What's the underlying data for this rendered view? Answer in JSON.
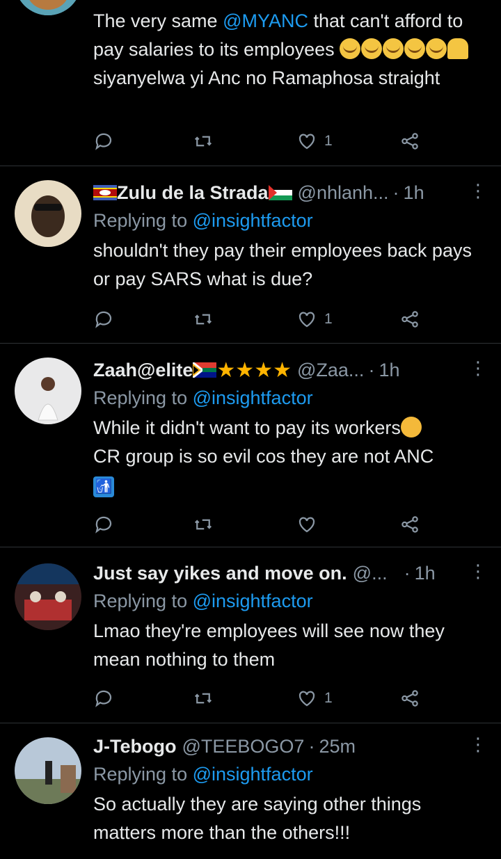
{
  "tweets": [
    {
      "text_parts": [
        "The very same ",
        "@MYANC",
        " that can't afford to pay salaries to its employees ",
        " siyanyelwa  yi Anc no Ramaphosa  straight"
      ],
      "reply_count": "",
      "retweet_count": "",
      "like_count": "1"
    },
    {
      "name": "Zulu de la Strada",
      "handle": "@nhlanh...",
      "dot": "·",
      "time": "1h",
      "replying_prefix": "Replying to ",
      "replying_to": "@insightfactor",
      "text": "shouldn't they pay their employees back pays or pay SARS what is due?",
      "like_count": "1"
    },
    {
      "name": "Zaah@elite",
      "handle": "@Zaa...",
      "dot": "·",
      "time": "1h",
      "replying_prefix": "Replying to ",
      "replying_to": "@insightfactor",
      "text_a": "While it didn't want to pay its workers",
      "text_b": "CR group is so evil cos they are not ANC",
      "like_count": ""
    },
    {
      "name": "Just say yikes and move on.",
      "handle": "@...",
      "dot": "·",
      "time": "1h",
      "replying_prefix": "Replying to ",
      "replying_to": "@insightfactor",
      "text": "Lmao they're employees will see now they mean nothing to them",
      "like_count": "1"
    },
    {
      "name": "J-Tebogo",
      "handle": "@TEEBOGO7",
      "dot": "·",
      "time": "25m",
      "replying_prefix": "Replying to ",
      "replying_to": "@insightfactor",
      "text": "So actually they are saying other things matters more than the others!!!"
    }
  ],
  "icons": {
    "reply": "reply-icon",
    "retweet": "retweet-icon",
    "like": "heart-icon",
    "share": "share-icon",
    "more": "more-icon"
  },
  "colors": {
    "background": "#000000",
    "text": "#e7e9ea",
    "secondary": "#8b98a5",
    "link": "#1d9bf0",
    "divider": "#2f3336"
  }
}
